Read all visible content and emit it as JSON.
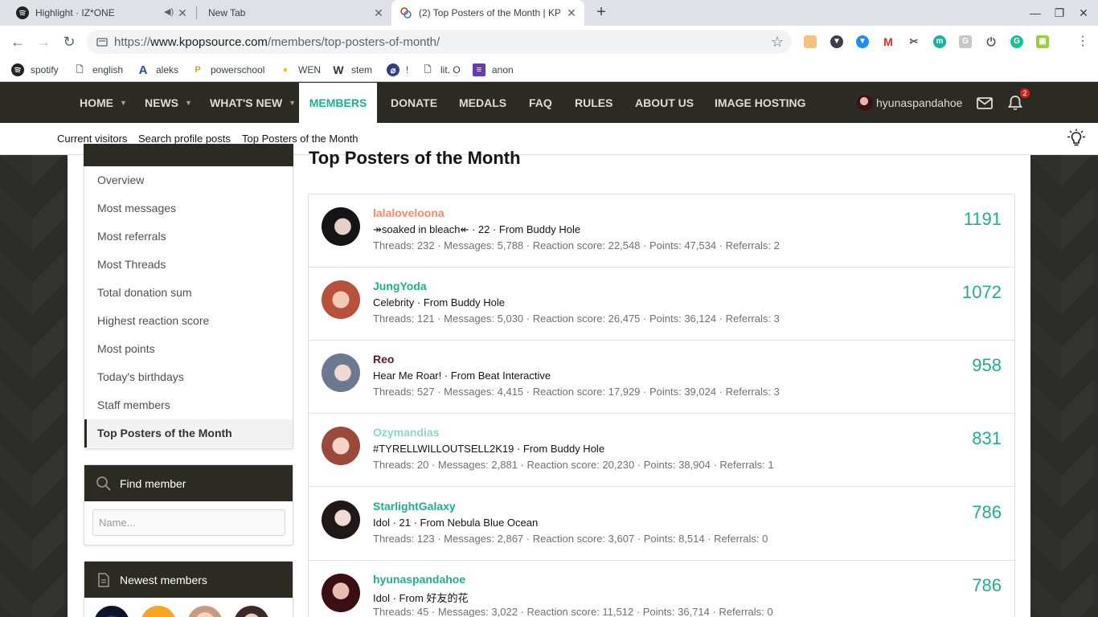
{
  "browser": {
    "tabs": [
      {
        "title": "Highlight · IZ*ONE",
        "audio": true
      },
      {
        "title": "New Tab"
      },
      {
        "title": "(2) Top Posters of the Month | KP",
        "active": true
      }
    ],
    "url": {
      "scheme": "https://",
      "domain": "www.kpopsource.com",
      "path": "/members/top-posters-of-month/"
    },
    "bookmarks": [
      "spotify",
      "english",
      "aleks",
      "powerschool",
      "WEN",
      "stem",
      "!",
      "lit. O",
      "anon"
    ]
  },
  "site": {
    "nav": [
      {
        "label": "HOME",
        "dropdown": true
      },
      {
        "label": "NEWS",
        "dropdown": true
      },
      {
        "label": "WHAT'S NEW",
        "dropdown": true
      },
      {
        "label": "MEMBERS",
        "active": true
      },
      {
        "label": "DONATE"
      },
      {
        "label": "MEDALS"
      },
      {
        "label": "FAQ"
      },
      {
        "label": "RULES"
      },
      {
        "label": "ABOUT US"
      },
      {
        "label": "IMAGE HOSTING"
      }
    ],
    "username": "hyunaspandahoe",
    "notification_count": "2",
    "subnav": [
      "Current visitors",
      "Search profile posts",
      "Top Posters of the Month"
    ],
    "accent_color": "#1fae90",
    "nav_bg": "#2b2b24"
  },
  "sidebar": {
    "menu": [
      "Overview",
      "Most messages",
      "Most referrals",
      "Most Threads",
      "Total donation sum",
      "Highest reaction score",
      "Most points",
      "Today's birthdays",
      "Staff members",
      "Top Posters of the Month"
    ],
    "selected": "Top Posters of the Month",
    "find_member": {
      "title": "Find member",
      "placeholder": "Name..."
    },
    "newest_members": {
      "title": "Newest members"
    }
  },
  "main": {
    "title": "Top Posters of the Month",
    "posters": [
      {
        "name": "lalaloveloona",
        "name_color": "#f28b6b",
        "blurb": "↠soaked in bleach↞ · 22 · From Buddy Hole",
        "stats": "Threads: 232 · Messages: 5,788 · Reaction score: 22,548 · Points: 47,534 · Referrals: 2",
        "count": "1191"
      },
      {
        "name": "JungYoda",
        "name_color": "#1fae90",
        "blurb": "Celebrity · From Buddy Hole",
        "stats": "Threads: 121 · Messages: 5,030 · Reaction score: 26,475 · Points: 36,124 · Referrals: 3",
        "count": "1072"
      },
      {
        "name": "Reo",
        "name_color": "#5a1a2a",
        "blurb": "Hear Me Roar! · From Beat Interactive",
        "stats": "Threads: 527 · Messages: 4,415 · Reaction score: 17,929 · Points: 39,024 · Referrals: 3",
        "count": "958"
      },
      {
        "name": "Ozymandias",
        "name_color": "#8fd6c6",
        "blurb": "#TYRELLWILLOUTSELL2K19 · From Buddy Hole",
        "stats": "Threads: 20 · Messages: 2,881 · Reaction score: 20,230 · Points: 38,904 · Referrals: 1",
        "count": "831"
      },
      {
        "name": "StarlightGalaxy",
        "name_color": "#1fae90",
        "blurb": "Idol · 21 · From Nebula Blue Ocean",
        "stats": "Threads: 123 · Messages: 2,867 · Reaction score: 3,607 · Points: 8,514 · Referrals: 0",
        "count": "786"
      },
      {
        "name": "hyunaspandahoe",
        "name_color": "#1fae90",
        "blurb": "Idol · From 好友的花",
        "stats": "Threads: 45 · Messages: 3,022 · Reaction score: 11,512 · Points: 36,714 · Referrals: 0",
        "count": "786"
      }
    ]
  }
}
